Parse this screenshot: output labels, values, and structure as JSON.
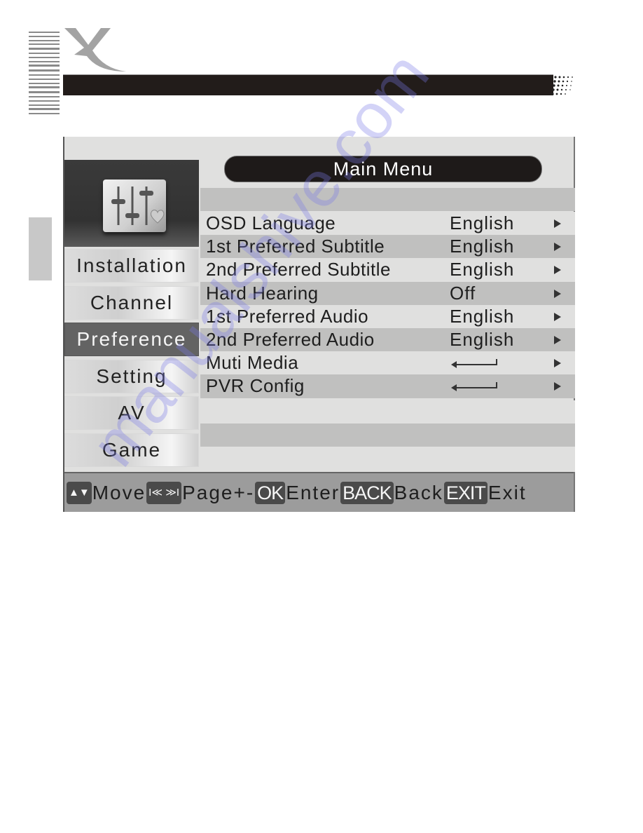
{
  "page": {
    "brand_logo": "X",
    "watermark": "manualshive.com"
  },
  "screen": {
    "title": "Main Menu",
    "category_icon": "equalizer-heart-icon",
    "sidebar": [
      {
        "label": "Installation",
        "active": false
      },
      {
        "label": "Channel",
        "active": false
      },
      {
        "label": "Preference",
        "active": true
      },
      {
        "label": "Setting",
        "active": false
      },
      {
        "label": "AV",
        "active": false
      },
      {
        "label": "Game",
        "active": false
      }
    ],
    "settings": [
      {
        "label": "OSD Language",
        "value": "English",
        "type": "option"
      },
      {
        "label": "1st Preferred Subtitle",
        "value": "English",
        "type": "option"
      },
      {
        "label": "2nd Preferred Subtitle",
        "value": "English",
        "type": "option"
      },
      {
        "label": "Hard Hearing",
        "value": "Off",
        "type": "option"
      },
      {
        "label": "1st Preferred Audio",
        "value": "English",
        "type": "option"
      },
      {
        "label": "2nd Preferred Audio",
        "value": "English",
        "type": "option"
      },
      {
        "label": "Muti Media",
        "value": "enter-arrow-icon",
        "type": "submenu"
      },
      {
        "label": "PVR Config",
        "value": "enter-arrow-icon",
        "type": "submenu"
      }
    ],
    "footer": {
      "move_key": "▲▼",
      "move_label": "Move",
      "page_key": "I≪ ≫I",
      "page_label": "Page+-",
      "ok_key": "OK",
      "ok_label": "Enter",
      "back_key": "BACK",
      "back_label": "Back",
      "exit_key": "EXIT",
      "exit_label": "Exit"
    }
  },
  "colors": {
    "header_bar": "#221c1a",
    "active_item": "#636363",
    "row_light": "#e0e0df",
    "row_dark": "#c0c0bf",
    "footer": "#9c9c9c",
    "key_bg": "#4a4a4a"
  }
}
